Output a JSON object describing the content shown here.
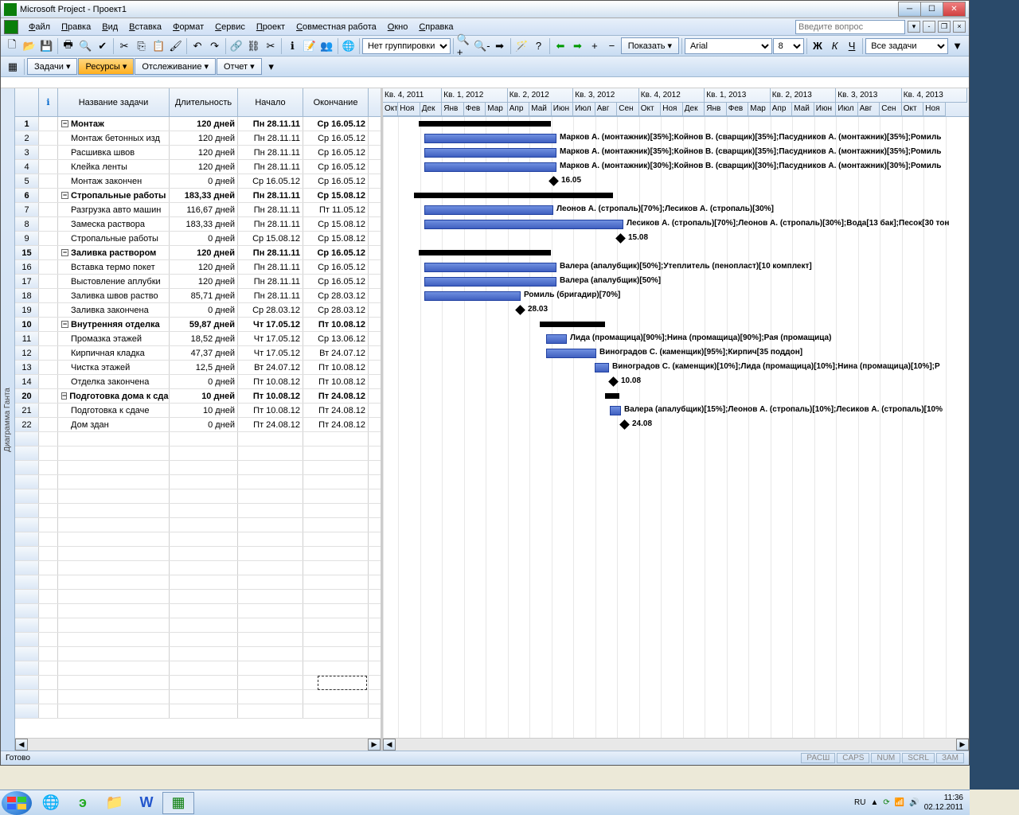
{
  "title": "Microsoft Project - Проект1",
  "menu": [
    "Файл",
    "Правка",
    "Вид",
    "Вставка",
    "Формат",
    "Сервис",
    "Проект",
    "Совместная работа",
    "Окно",
    "Справка"
  ],
  "askbox": "Введите вопрос",
  "toolbar": {
    "group": "Нет группировки",
    "show": "Показать",
    "font": "Arial",
    "size": "8",
    "filter": "Все задачи"
  },
  "viewbar": {
    "tasks": "Задачи",
    "resources": "Ресурсы",
    "tracking": "Отслеживание",
    "report": "Отчет"
  },
  "cols": {
    "name": "Название задачи",
    "dur": "Длительность",
    "start": "Начало",
    "end": "Окончание"
  },
  "timeline_q": [
    "Кв. 4, 2011",
    "Кв. 1, 2012",
    "Кв. 2, 2012",
    "Кв. 3, 2012",
    "Кв. 4, 2012",
    "Кв. 1, 2013",
    "Кв. 2, 2013",
    "Кв. 3, 2013",
    "Кв. 4, 2013"
  ],
  "timeline_m": [
    "Окт",
    "Ноя",
    "Дек",
    "Янв",
    "Фев",
    "Мар",
    "Апр",
    "Май",
    "Июн",
    "Июл",
    "Авг",
    "Сен",
    "Окт",
    "Ноя",
    "Дек",
    "Янв",
    "Фев",
    "Мар",
    "Апр",
    "Май",
    "Июн",
    "Июл",
    "Авг",
    "Сен",
    "Окт",
    "Ноя"
  ],
  "rows": [
    {
      "n": "1",
      "name": "Монтаж",
      "dur": "120 дней",
      "s": "Пн 28.11.11",
      "e": "Ср 16.05.12",
      "sum": true,
      "bar": [
        45,
        166
      ],
      "lbl": ""
    },
    {
      "n": "2",
      "name": "Монтаж бетонных изд",
      "dur": "120 дней",
      "s": "Пн 28.11.11",
      "e": "Ср 16.05.12",
      "bar": [
        52,
        166
      ],
      "lbl": "Марков А. (монтажник)[35%];Койнов В. (сварщик)[35%];Пасудников А. (монтажник)[35%];Ромиль"
    },
    {
      "n": "3",
      "name": "Расшивка швов",
      "dur": "120 дней",
      "s": "Пн 28.11.11",
      "e": "Ср 16.05.12",
      "bar": [
        52,
        166
      ],
      "lbl": "Марков А. (монтажник)[35%];Койнов В. (сварщик)[35%];Пасудников А. (монтажник)[35%];Ромиль"
    },
    {
      "n": "4",
      "name": "Клейка ленты",
      "dur": "120 дней",
      "s": "Пн 28.11.11",
      "e": "Ср 16.05.12",
      "bar": [
        52,
        166
      ],
      "lbl": "Марков А. (монтажник)[30%];Койнов В. (сварщик)[30%];Пасудников А. (монтажник)[30%];Ромиль"
    },
    {
      "n": "5",
      "name": "Монтаж закончен",
      "dur": "0 дней",
      "s": "Ср 16.05.12",
      "e": "Ср 16.05.12",
      "ms": 210,
      "lbl": "16.05"
    },
    {
      "n": "6",
      "name": "Стропальные работы",
      "dur": "183,33 дней",
      "s": "Пн 28.11.11",
      "e": "Ср 15.08.12",
      "sum": true,
      "bar": [
        39,
        250
      ],
      "lbl": ""
    },
    {
      "n": "7",
      "name": "Разгрузка авто машин",
      "dur": "116,67 дней",
      "s": "Пн 28.11.11",
      "e": "Пт 11.05.12",
      "bar": [
        52,
        162
      ],
      "lbl": "Леонов А. (стропаль)[70%];Лесиков А. (стропаль)[30%]"
    },
    {
      "n": "8",
      "name": "Замеска раствора",
      "dur": "183,33 дней",
      "s": "Пн 28.11.11",
      "e": "Ср 15.08.12",
      "bar": [
        52,
        250
      ],
      "lbl": "Лесиков А. (стропаль)[70%];Леонов А. (стропаль)[30%];Вода[13 бак];Песок[30 тон"
    },
    {
      "n": "9",
      "name": "Стропальные работы",
      "dur": "0 дней",
      "s": "Ср 15.08.12",
      "e": "Ср 15.08.12",
      "ms": 294,
      "lbl": "15.08"
    },
    {
      "n": "15",
      "name": "Заливка раствором",
      "dur": "120 дней",
      "s": "Пн 28.11.11",
      "e": "Ср 16.05.12",
      "sum": true,
      "bar": [
        45,
        166
      ],
      "lbl": ""
    },
    {
      "n": "16",
      "name": "Вставка термо покет",
      "dur": "120 дней",
      "s": "Пн 28.11.11",
      "e": "Ср 16.05.12",
      "bar": [
        52,
        166
      ],
      "lbl": "Валера (апалубщик)[50%];Утеплитель (пенопласт)[10 комплект]"
    },
    {
      "n": "17",
      "name": "Выстовление аплубки",
      "dur": "120 дней",
      "s": "Пн 28.11.11",
      "e": "Ср 16.05.12",
      "bar": [
        52,
        166
      ],
      "lbl": "Валера (апалубщик)[50%]"
    },
    {
      "n": "18",
      "name": "Заливка швов раство",
      "dur": "85,71 дней",
      "s": "Пн 28.11.11",
      "e": "Ср 28.03.12",
      "bar": [
        52,
        121
      ],
      "lbl": "Ромиль (бригадир)[70%]"
    },
    {
      "n": "19",
      "name": "Заливка закончена",
      "dur": "0 дней",
      "s": "Ср 28.03.12",
      "e": "Ср 28.03.12",
      "ms": 168,
      "lbl": "28.03"
    },
    {
      "n": "10",
      "name": "Внутренняя отделка",
      "dur": "59,87 дней",
      "s": "Чт 17.05.12",
      "e": "Пт 10.08.12",
      "sum": true,
      "bar": [
        197,
        82
      ],
      "lbl": ""
    },
    {
      "n": "11",
      "name": "Промазка этажей",
      "dur": "18,52 дней",
      "s": "Чт 17.05.12",
      "e": "Ср 13.06.12",
      "bar": [
        205,
        26
      ],
      "lbl": "Лида (промащица)[90%];Нина (промащица)[90%];Рая (промащица)"
    },
    {
      "n": "12",
      "name": "Кирпичная кладка",
      "dur": "47,37 дней",
      "s": "Чт 17.05.12",
      "e": "Вт 24.07.12",
      "bar": [
        205,
        63
      ],
      "lbl": "Виноградов С. (каменщик)[95%];Кирпич[35 поддон]"
    },
    {
      "n": "13",
      "name": "Чистка этажей",
      "dur": "12,5 дней",
      "s": "Вт 24.07.12",
      "e": "Пт 10.08.12",
      "bar": [
        266,
        18
      ],
      "lbl": "Виноградов С. (каменщик)[10%];Лида (промащица)[10%];Нина (промащица)[10%];Р"
    },
    {
      "n": "14",
      "name": "Отделка закончена",
      "dur": "0 дней",
      "s": "Пт 10.08.12",
      "e": "Пт 10.08.12",
      "ms": 285,
      "lbl": "10.08"
    },
    {
      "n": "20",
      "name": "Подготовка дома к сда",
      "dur": "10 дней",
      "s": "Пт 10.08.12",
      "e": "Пт 24.08.12",
      "sum": true,
      "bar": [
        279,
        18
      ],
      "lbl": ""
    },
    {
      "n": "21",
      "name": "Подготовка к сдаче",
      "dur": "10 дней",
      "s": "Пт 10.08.12",
      "e": "Пт 24.08.12",
      "bar": [
        285,
        14
      ],
      "lbl": "Валера (апалубщик)[15%];Леонов А. (стропаль)[10%];Лесиков А. (стропаль)[10%"
    },
    {
      "n": "22",
      "name": "Дом здан",
      "dur": "0 дней",
      "s": "Пт 24.08.12",
      "e": "Пт 24.08.12",
      "ms": 299,
      "lbl": "24.08"
    }
  ],
  "status": {
    "ready": "Готово",
    "ext": "РАСШ",
    "caps": "CAPS",
    "num": "NUM",
    "scrl": "SCRL",
    "ovr": "ЗАМ"
  },
  "tray": {
    "lang": "RU",
    "time": "11:36",
    "date": "02.12.2011"
  },
  "sidelabel": "Диаграмма Ганта"
}
